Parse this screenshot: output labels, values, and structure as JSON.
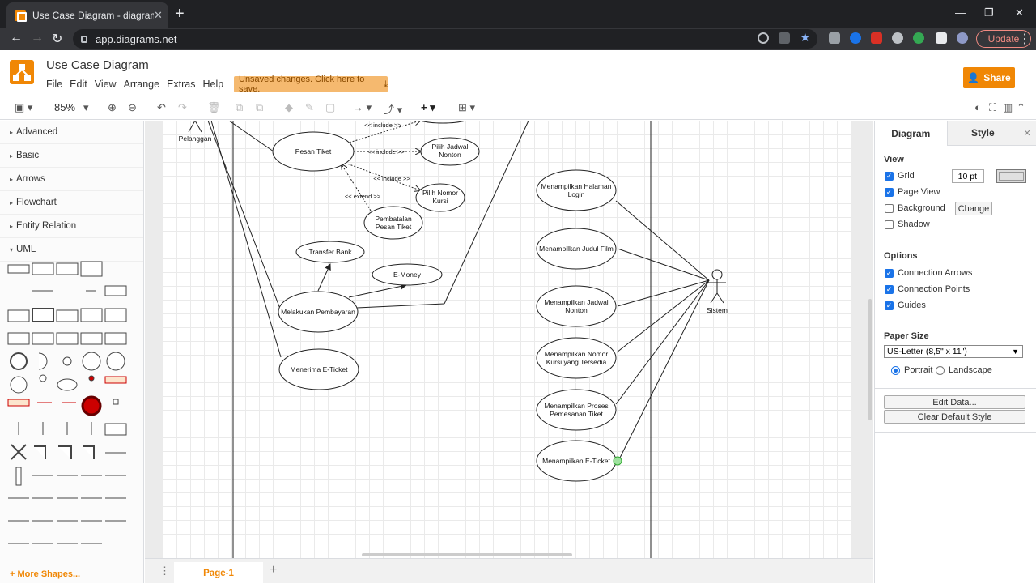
{
  "browser": {
    "tab_title": "Use Case Diagram - diagrams.ne",
    "url": "app.diagrams.net",
    "update_label": "Update"
  },
  "app": {
    "doc_title": "Use Case Diagram",
    "menu": [
      "File",
      "Edit",
      "View",
      "Arrange",
      "Extras",
      "Help"
    ],
    "unsaved_label": "Unsaved changes. Click here to save.",
    "share_label": "Share",
    "zoom": "85%"
  },
  "sidebar": {
    "categories": [
      "Advanced",
      "Basic",
      "Arrows",
      "Flowchart",
      "Entity Relation",
      "UML"
    ],
    "more_shapes": "+ More Shapes..."
  },
  "diagram": {
    "actors": {
      "pelanggan": "Pelanggan",
      "sistem": "Sistem"
    },
    "left_cases": {
      "pesan_tiket": "Pesan Tiket",
      "pilih_jadwal_1": "Pilih Jadwal",
      "pilih_jadwal_2": "Nonton",
      "pilih_kursi_1": "Pilih Nomor",
      "pilih_kursi_2": "Kursi",
      "pembatalan_1": "Pembatalan",
      "pembatalan_2": "Pesan Tiket",
      "transfer_bank": "Transfer Bank",
      "emoney": "E-Money",
      "pembayaran": "Melakukan Pembayaran",
      "eticket": "Menerima E-Ticket"
    },
    "labels": {
      "include": "<< include >>",
      "extend": "<< extend >>"
    },
    "right_cases": {
      "c1a": "Menampilkan Halaman",
      "c1b": "Login",
      "c2": "Menampilkan Judul Film",
      "c3a": "Menampilkan Jadwal",
      "c3b": "Nonton",
      "c4a": "Menampilkan Nomor",
      "c4b": "Kursi yang Tersedia",
      "c5a": "Menampilkan Proses",
      "c5b": "Pemesanan Tiket",
      "c6": "Menampilkan E-Ticket"
    }
  },
  "page_tab": "Page-1",
  "panel": {
    "tab_diagram": "Diagram",
    "tab_style": "Style",
    "view_title": "View",
    "grid": "Grid",
    "grid_size": "10 pt",
    "page_view": "Page View",
    "background": "Background",
    "change": "Change",
    "shadow": "Shadow",
    "options_title": "Options",
    "connection_arrows": "Connection Arrows",
    "connection_points": "Connection Points",
    "guides": "Guides",
    "paper_title": "Paper Size",
    "paper_value": "US-Letter (8,5\" x 11\")",
    "portrait": "Portrait",
    "landscape": "Landscape",
    "edit_data": "Edit Data...",
    "clear_style": "Clear Default Style"
  },
  "colors": {
    "accent": "#f08705",
    "checkbox": "#1a73e8"
  }
}
